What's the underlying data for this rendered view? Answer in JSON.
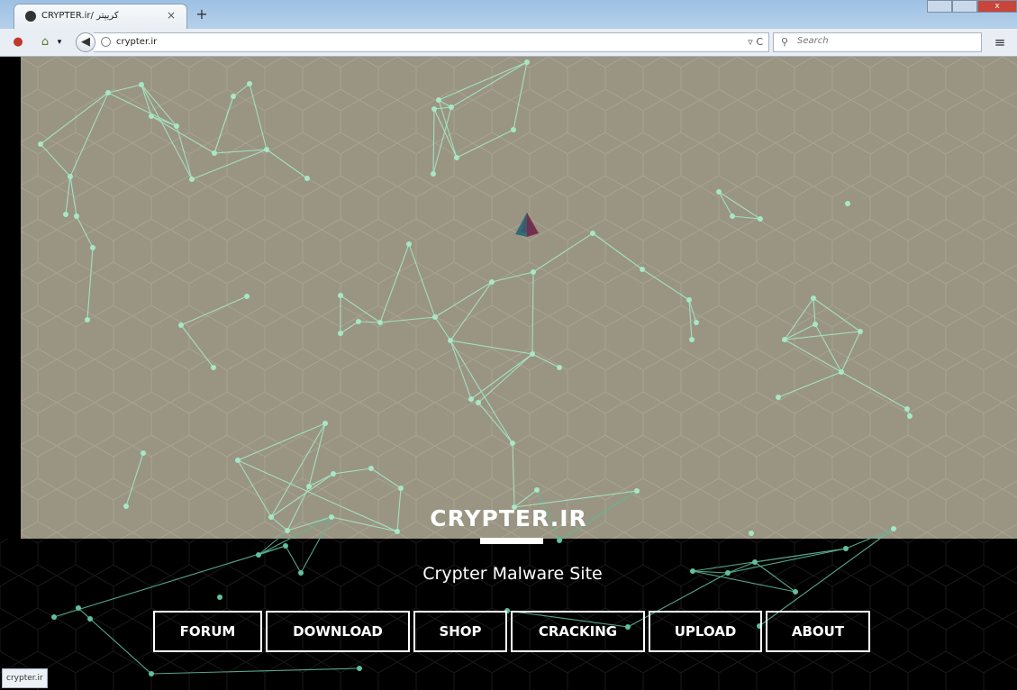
{
  "browser": {
    "tab_title": "CRYPTER.ir/ کریپتر",
    "tab_close": "×",
    "new_tab": "+",
    "url": "crypter.ir",
    "search_placeholder": "Search",
    "status_url": "crypter.ir",
    "icons": [
      "firefox-icon",
      "home-icon",
      "back-arrow-icon",
      "globe-icon",
      "reload-icon",
      "search-icon",
      "hamburger-menu-icon"
    ]
  },
  "site": {
    "title": "CRYPTER.IR",
    "subtitle": "Crypter Malware Site",
    "nav": [
      "FORUM",
      "DOWNLOAD",
      "SHOP",
      "CRACKING",
      "UPLOAD",
      "ABOUT"
    ]
  },
  "colors": {
    "hero_bg": "#999582",
    "network": "#9de2bc",
    "page_bg": "#000000"
  }
}
